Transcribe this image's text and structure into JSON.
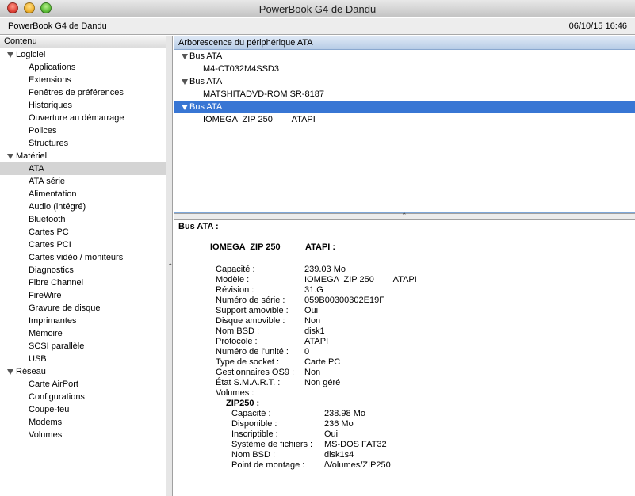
{
  "window": {
    "title": "PowerBook G4 de Dandu"
  },
  "infobar": {
    "machine": "PowerBook G4 de Dandu",
    "date": "06/10/15 16:46"
  },
  "sidebar": {
    "header": "Contenu",
    "groups": [
      {
        "label": "Logiciel",
        "items": [
          "Applications",
          "Extensions",
          "Fenêtres de préférences",
          "Historiques",
          "Ouverture au démarrage",
          "Polices",
          "Structures"
        ]
      },
      {
        "label": "Matériel",
        "items": [
          "ATA",
          "ATA série",
          "Alimentation",
          "Audio (intégré)",
          "Bluetooth",
          "Cartes PC",
          "Cartes PCI",
          "Cartes vidéo / moniteurs",
          "Diagnostics",
          "Fibre Channel",
          "FireWire",
          "Gravure de disque",
          "Imprimantes",
          "Mémoire",
          "SCSI parallèle",
          "USB"
        ]
      },
      {
        "label": "Réseau",
        "items": [
          "Carte AirPort",
          "Configurations",
          "Coupe-feu",
          "Modems",
          "Volumes"
        ]
      }
    ],
    "selected": "ATA"
  },
  "device_tree": {
    "header": "Arborescence du périphérique ATA",
    "buses": [
      {
        "label": "Bus ATA",
        "device": "M4-CT032M4SSD3"
      },
      {
        "label": "Bus ATA",
        "device": "MATSHITADVD-ROM SR-8187"
      },
      {
        "label": "Bus ATA",
        "device": "IOMEGA  ZIP 250        ATAPI"
      }
    ]
  },
  "detail": {
    "heading": "Bus ATA :",
    "device_name": "IOMEGA  ZIP 250",
    "device_type": "ATAPI :",
    "props": [
      {
        "k": "Capacité :",
        "v": "239.03 Mo"
      },
      {
        "k": "Modèle :",
        "v": "IOMEGA  ZIP 250        ATAPI"
      },
      {
        "k": "Révision :",
        "v": "31.G"
      },
      {
        "k": "Numéro de série :",
        "v": "059B00300302E19F"
      },
      {
        "k": "Support amovible :",
        "v": "Oui"
      },
      {
        "k": "Disque amovible :",
        "v": "Non"
      },
      {
        "k": "Nom BSD :",
        "v": "disk1"
      },
      {
        "k": "Protocole :",
        "v": "ATAPI"
      },
      {
        "k": "Numéro de l'unité :",
        "v": "0"
      },
      {
        "k": "Type de socket :",
        "v": "Carte PC"
      },
      {
        "k": "Gestionnaires OS9 :",
        "v": "Non"
      },
      {
        "k": "État S.M.A.R.T. :",
        "v": "Non géré"
      },
      {
        "k": "Volumes :",
        "v": ""
      }
    ],
    "volume_name": "ZIP250 :",
    "volume_props": [
      {
        "k": "Capacité :",
        "v": "238.98 Mo"
      },
      {
        "k": "Disponible :",
        "v": "236 Mo"
      },
      {
        "k": "Inscriptible :",
        "v": "Oui"
      },
      {
        "k": "Système de fichiers :",
        "v": "MS-DOS FAT32"
      },
      {
        "k": "Nom BSD :",
        "v": "disk1s4"
      },
      {
        "k": "Point de montage :",
        "v": "/Volumes/ZIP250"
      }
    ]
  }
}
